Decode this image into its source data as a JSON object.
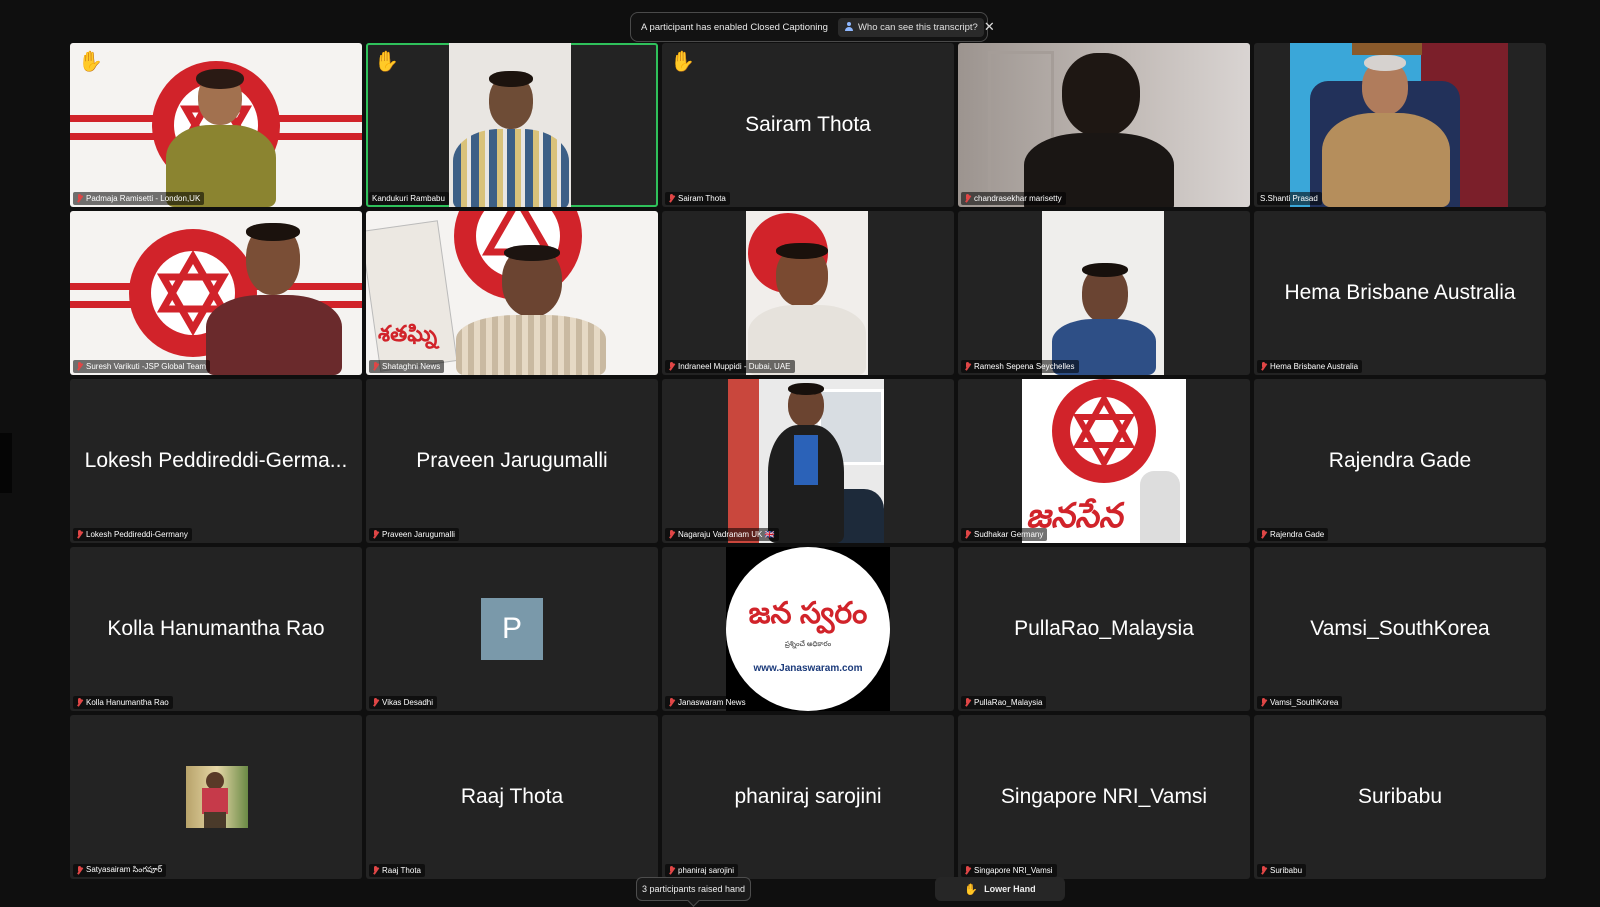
{
  "banner": {
    "message": "A participant has enabled Closed Captioning",
    "who_button": "Who can see this transcript?",
    "close_icon": "close-icon"
  },
  "tiles": [
    {
      "label": "Padmaja Ramisetti - London,UK",
      "hand": true
    },
    {
      "label": "Kandukuri Rambabu",
      "hand": true,
      "active": true
    },
    {
      "label": "Sairam Thota",
      "display": "Sairam Thota",
      "hand": true
    },
    {
      "label": "chandrasekhar marisetty"
    },
    {
      "label": "S.Shanti Prasad"
    },
    {
      "label": "Suresh  Varikuti -JSP Global Team"
    },
    {
      "label": "Shataghni News"
    },
    {
      "label": "Indraneel Muppidi - Dubai, UAE"
    },
    {
      "label": "Ramesh Sepena Seychelles"
    },
    {
      "label": "Hema Brisbane Australia",
      "display": "Hema Brisbane Australia"
    },
    {
      "label": "Lokesh Peddireddi-Germany",
      "display": "Lokesh Peddireddi-Germa..."
    },
    {
      "label": "Praveen Jarugumalli",
      "display": "Praveen Jarugumalli"
    },
    {
      "label": "Nagaraju Vadranam UK 🇬🇧"
    },
    {
      "label": "Sudhakar Germany",
      "logo_text": "జనసేన"
    },
    {
      "label": "Rajendra Gade",
      "display": "Rajendra Gade"
    },
    {
      "label": "Kolla Hanumantha Rao",
      "display": "Kolla Hanumantha Rao"
    },
    {
      "label": "Vikas Desadhi",
      "avatar_letter": "P"
    },
    {
      "label": "Janaswaram News",
      "logo_text": "జన స్వరం",
      "logo_sub": "www.Janaswaram.com",
      "logo_tag": "ప్రశ్నించే అధికారం"
    },
    {
      "label": "PullaRao_Malaysia",
      "display": "PullaRao_Malaysia"
    },
    {
      "label": "Vamsi_SouthKorea",
      "display": "Vamsi_SouthKorea"
    },
    {
      "label": "Satyasairam సింగపూర్"
    },
    {
      "label": "Raaj Thota",
      "display": "Raaj Thota"
    },
    {
      "label": "phaniraj sarojini",
      "display": "phaniraj sarojini"
    },
    {
      "label": "Singapore NRI_Vamsi",
      "display": "Singapore NRI_Vamsi"
    },
    {
      "label": "Suribabu",
      "display": "Suribabu"
    }
  ],
  "shataghni_text": "శతఘ్ని",
  "bottom": {
    "raised_hands": "3 participants raised hand",
    "lower_hand": "Lower Hand"
  },
  "colors": {
    "party_red": "#d1232a",
    "active_speaker": "#2fc15b",
    "tile_bg": "#232323"
  },
  "icons": {
    "hand": "raised-hand-icon",
    "mic": "mic-off-icon"
  }
}
